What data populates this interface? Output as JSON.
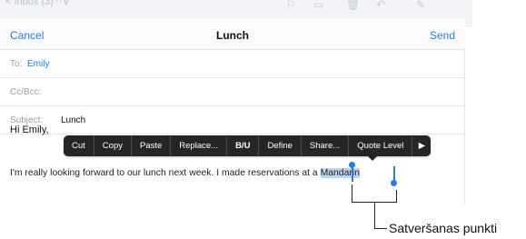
{
  "background": {
    "inbox_label": "< Inbox (3)  ^  v",
    "icons": [
      "flag-icon",
      "folder-icon",
      "trash-icon",
      "reply-icon",
      "compose-icon"
    ]
  },
  "nav": {
    "cancel": "Cancel",
    "title": "Lunch",
    "send": "Send"
  },
  "fields": {
    "to_label": "To:",
    "to_value": "Emily",
    "cc_label": "Cc/Bcc:",
    "subject_label": "Subject:",
    "subject_value": "Lunch"
  },
  "body": {
    "greeting": "Hi Emily,",
    "line_before": "I'm really looking forward to our lunch next week. I made reservations at a ",
    "selected_word": "Mandarin"
  },
  "edit_menu": {
    "items": [
      "Cut",
      "Copy",
      "Paste",
      "Replace...",
      "B/U",
      "Define",
      "Share...",
      "Quote Level",
      "▶"
    ]
  },
  "callout": {
    "label": "Satveršanas punkti"
  },
  "colors": {
    "accent": "#2b7cd6",
    "menu_bg": "#252525",
    "selection": "#bcd6f2"
  }
}
